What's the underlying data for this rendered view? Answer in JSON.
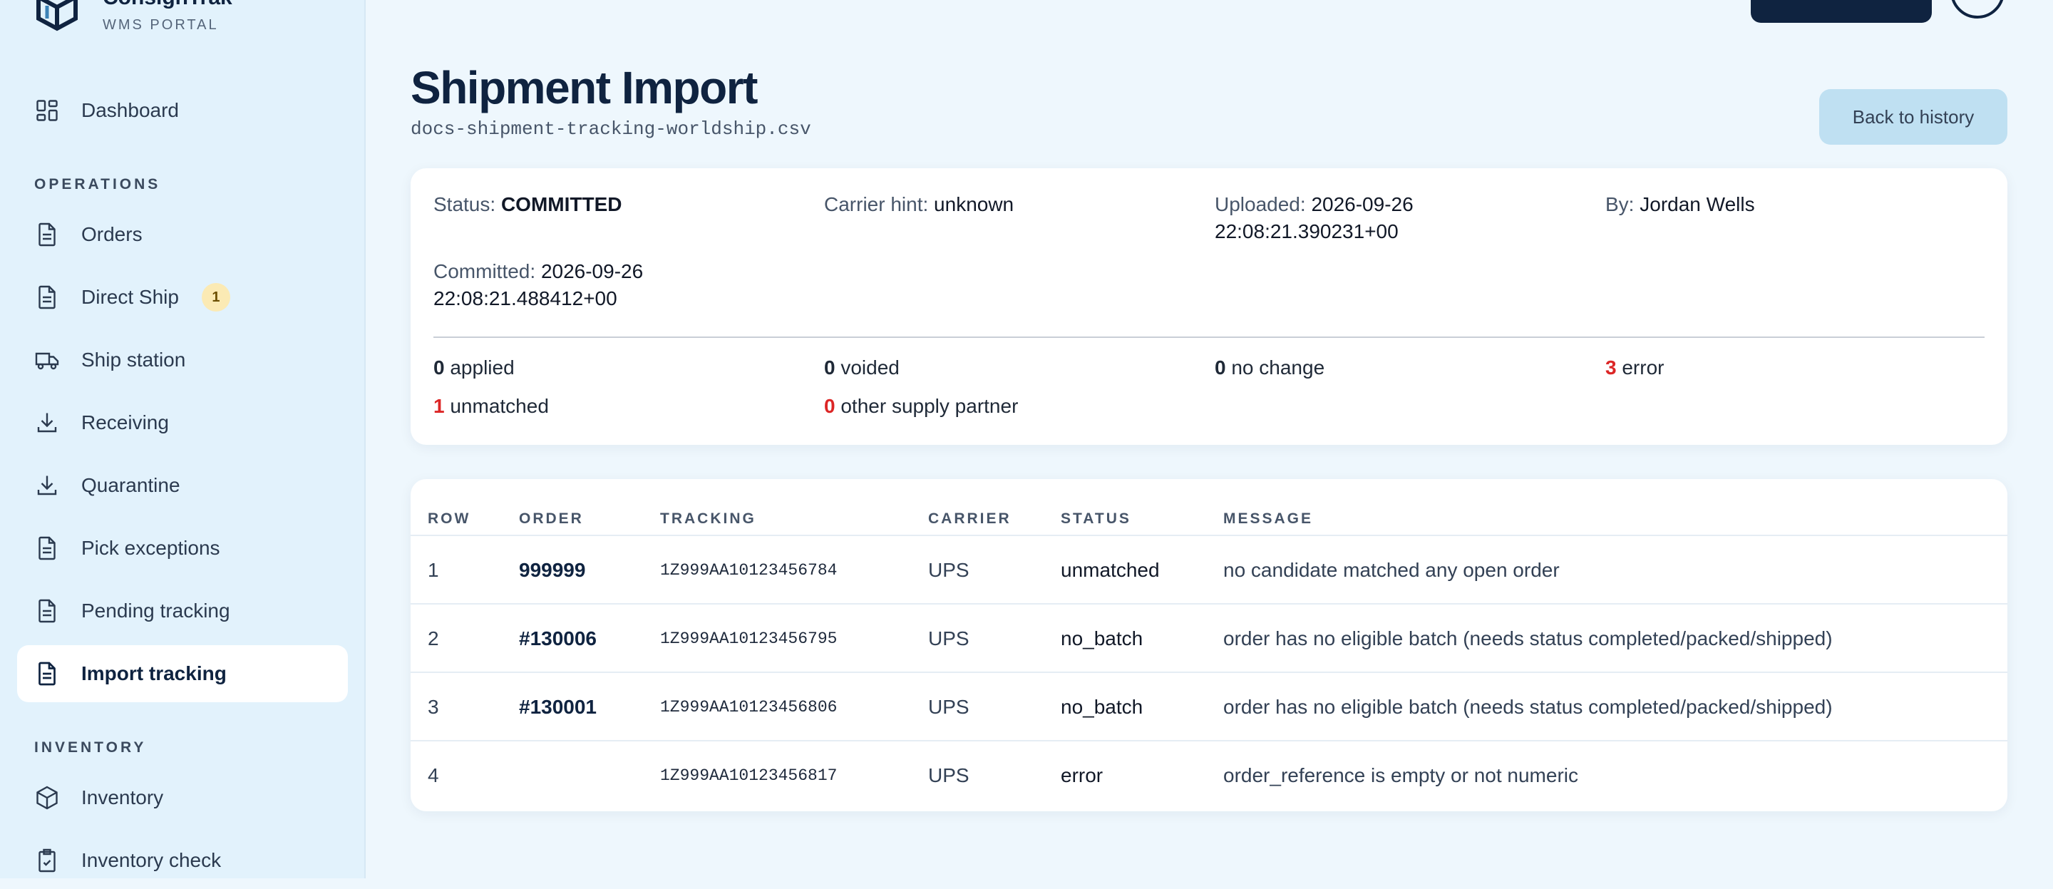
{
  "brand": {
    "name": "ConsignTrak",
    "subtitle": "WMS PORTAL"
  },
  "sidebar": {
    "items": [
      {
        "label": "Dashboard",
        "icon": "grid-icon"
      },
      {
        "label": "Orders",
        "icon": "document-icon"
      },
      {
        "label": "Direct Ship",
        "icon": "document-icon",
        "badge": "1"
      },
      {
        "label": "Ship station",
        "icon": "truck-icon"
      },
      {
        "label": "Receiving",
        "icon": "download-icon"
      },
      {
        "label": "Quarantine",
        "icon": "download-icon"
      },
      {
        "label": "Pick exceptions",
        "icon": "document-icon"
      },
      {
        "label": "Pending tracking",
        "icon": "document-icon"
      },
      {
        "label": "Import tracking",
        "icon": "document-icon",
        "active": true
      },
      {
        "label": "Inventory",
        "icon": "box-icon"
      },
      {
        "label": "Inventory check",
        "icon": "clipboard-check-icon"
      }
    ],
    "sections": {
      "operations": "OPERATIONS",
      "inventory": "INVENTORY"
    }
  },
  "header": {
    "title": "Shipment Import",
    "filename": "docs-shipment-tracking-worldship.csv",
    "back_label": "Back to history"
  },
  "summary": {
    "status_label": "Status:",
    "status_value": "COMMITTED",
    "carrier_label": "Carrier hint:",
    "carrier_value": "unknown",
    "uploaded_label": "Uploaded:",
    "uploaded_value": "2026-09-26",
    "uploaded_value_2": "22:08:21.390231+00",
    "by_label": "By:",
    "by_value": "Jordan Wells",
    "committed_label": "Committed:",
    "committed_value": "2026-09-26",
    "committed_value_2": "22:08:21.488412+00",
    "counts": {
      "applied": {
        "n": "0",
        "label": "applied"
      },
      "voided": {
        "n": "0",
        "label": "voided"
      },
      "no_change": {
        "n": "0",
        "label": "no change"
      },
      "error": {
        "n": "3",
        "label": "error"
      },
      "unmatched": {
        "n": "1",
        "label": "unmatched"
      },
      "other": {
        "n": "0",
        "label": "other supply partner"
      }
    }
  },
  "table": {
    "columns": [
      "ROW",
      "ORDER",
      "TRACKING",
      "CARRIER",
      "STATUS",
      "MESSAGE"
    ],
    "rows": [
      {
        "row": "1",
        "order": "999999",
        "tracking": "1Z999AA10123456784",
        "carrier": "UPS",
        "status": "unmatched",
        "message": "no candidate matched any open order"
      },
      {
        "row": "2",
        "order": "#130006",
        "tracking": "1Z999AA10123456795",
        "carrier": "UPS",
        "status": "no_batch",
        "message": "order has no eligible batch (needs status completed/packed/shipped)"
      },
      {
        "row": "3",
        "order": "#130001",
        "tracking": "1Z999AA10123456806",
        "carrier": "UPS",
        "status": "no_batch",
        "message": "order has no eligible batch (needs status completed/packed/shipped)"
      },
      {
        "row": "4",
        "order": "",
        "tracking": "1Z999AA10123456817",
        "carrier": "UPS",
        "status": "error",
        "message": "order_reference is empty or not numeric"
      }
    ]
  },
  "colors": {
    "accent": "#0f2340",
    "error": "#dc2626",
    "badge": "#fbeab4",
    "sidebar": "#e2f2fc",
    "background": "#eef7fd"
  }
}
